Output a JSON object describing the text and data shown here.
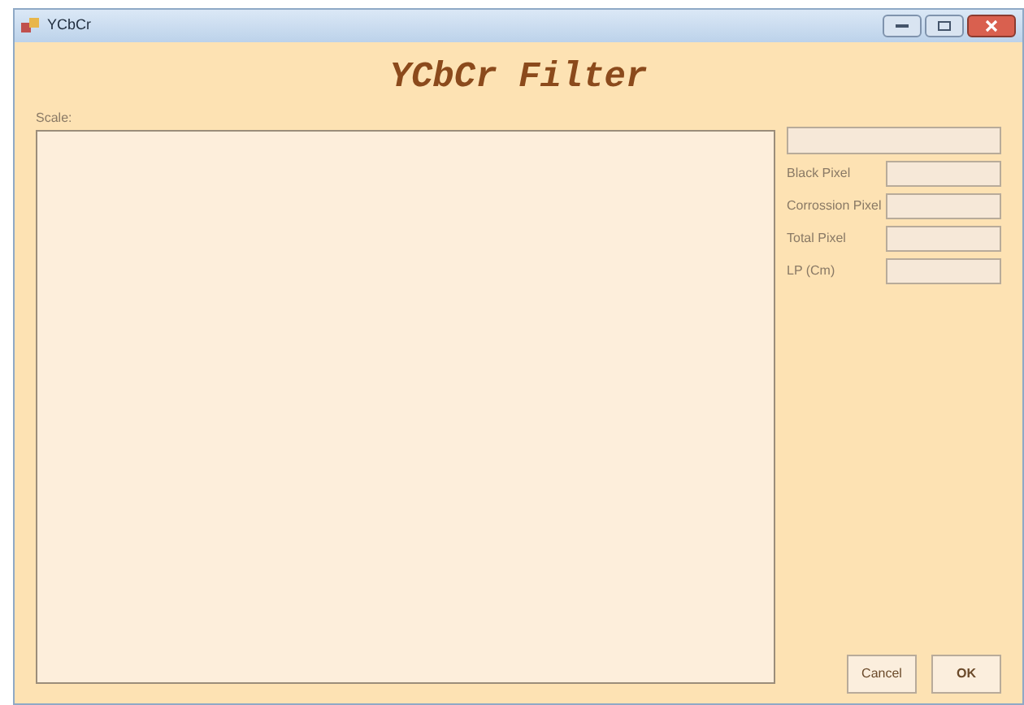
{
  "window": {
    "title": "YCbCr"
  },
  "heading": "YCbCr Filter",
  "scale_label": "Scale:",
  "fields": [
    {
      "label": "Black Pixel"
    },
    {
      "label": "Corrossion Pixel"
    },
    {
      "label": "Total Pixel"
    },
    {
      "label": "LP (Cm)"
    }
  ],
  "buttons": [
    "Cancel",
    "OK"
  ]
}
